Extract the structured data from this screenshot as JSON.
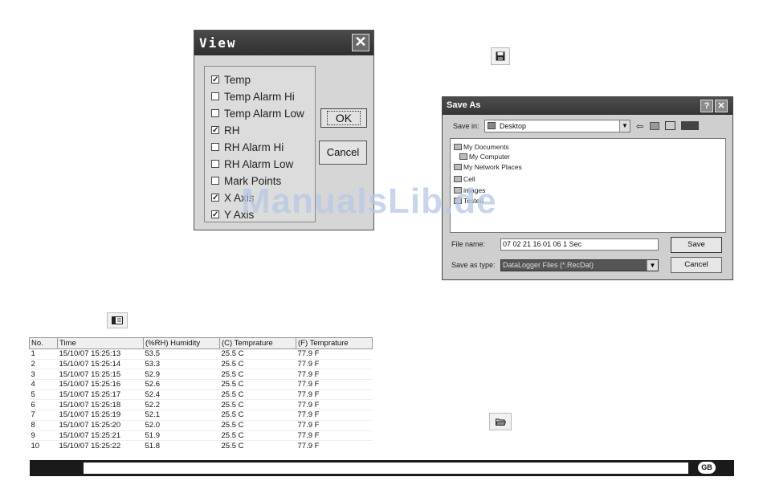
{
  "view_dialog": {
    "title": "View",
    "close_glyph": "✕",
    "options": [
      {
        "label": "Temp",
        "checked": true
      },
      {
        "label": "Temp Alarm Hi",
        "checked": false
      },
      {
        "label": "Temp Alarm Low",
        "checked": false
      },
      {
        "label": "RH",
        "checked": true
      },
      {
        "label": "RH Alarm Hi",
        "checked": false
      },
      {
        "label": "RH Alarm Low",
        "checked": false
      },
      {
        "label": "Mark Points",
        "checked": false
      },
      {
        "label": "X Axis",
        "checked": true
      },
      {
        "label": "Y Axis",
        "checked": true
      }
    ],
    "ok_label": "OK",
    "cancel_label": "Cancel"
  },
  "icons": {
    "save": "floppy-disk-icon",
    "table_view": "table-view-icon",
    "open": "open-folder-icon"
  },
  "save_as_dialog": {
    "title": "Save As",
    "help_glyph": "?",
    "close_glyph": "✕",
    "save_in_label": "Save in:",
    "save_in_value": "Desktop",
    "items": [
      "My Documents",
      "My Computer",
      "My Network Places",
      "Cell",
      "images",
      "Tested"
    ],
    "file_name_label": "File name:",
    "file_name_value": "07 02 21 16 01 06 1 Sec",
    "save_type_label": "Save as type:",
    "save_type_value": "DataLogger Files (*.RecDat)",
    "save_label": "Save",
    "cancel_label": "Cancel"
  },
  "watermark": "ManualsLib.de",
  "table": {
    "headers": [
      "No.",
      "Time",
      "(%RH) Humidity",
      "(C) Temprature",
      "(F) Temprature"
    ],
    "rows": [
      [
        "1",
        "15/10/07 15:25:13",
        "53.5",
        "25.5 C",
        "77.9 F"
      ],
      [
        "2",
        "15/10/07 15:25:14",
        "53.3",
        "25.5 C",
        "77.9 F"
      ],
      [
        "3",
        "15/10/07 15:25:15",
        "52.9",
        "25.5 C",
        "77.9 F"
      ],
      [
        "4",
        "15/10/07 15:25:16",
        "52.6",
        "25.5 C",
        "77.9 F"
      ],
      [
        "5",
        "15/10/07 15:25:17",
        "52.4",
        "25.5 C",
        "77.9 F"
      ],
      [
        "6",
        "15/10/07 15:25:18",
        "52.2",
        "25.5 C",
        "77.9 F"
      ],
      [
        "7",
        "15/10/07 15:25:19",
        "52.1",
        "25.5 C",
        "77.9 F"
      ],
      [
        "8",
        "15/10/07 15:25:20",
        "52.0",
        "25.5 C",
        "77.9 F"
      ],
      [
        "9",
        "15/10/07 15:25:21",
        "51.9",
        "25.5 C",
        "77.9 F"
      ],
      [
        "10",
        "15/10/07 15:25:22",
        "51.8",
        "25.5 C",
        "77.9 F"
      ]
    ]
  },
  "footer": {
    "badge": "GB"
  }
}
